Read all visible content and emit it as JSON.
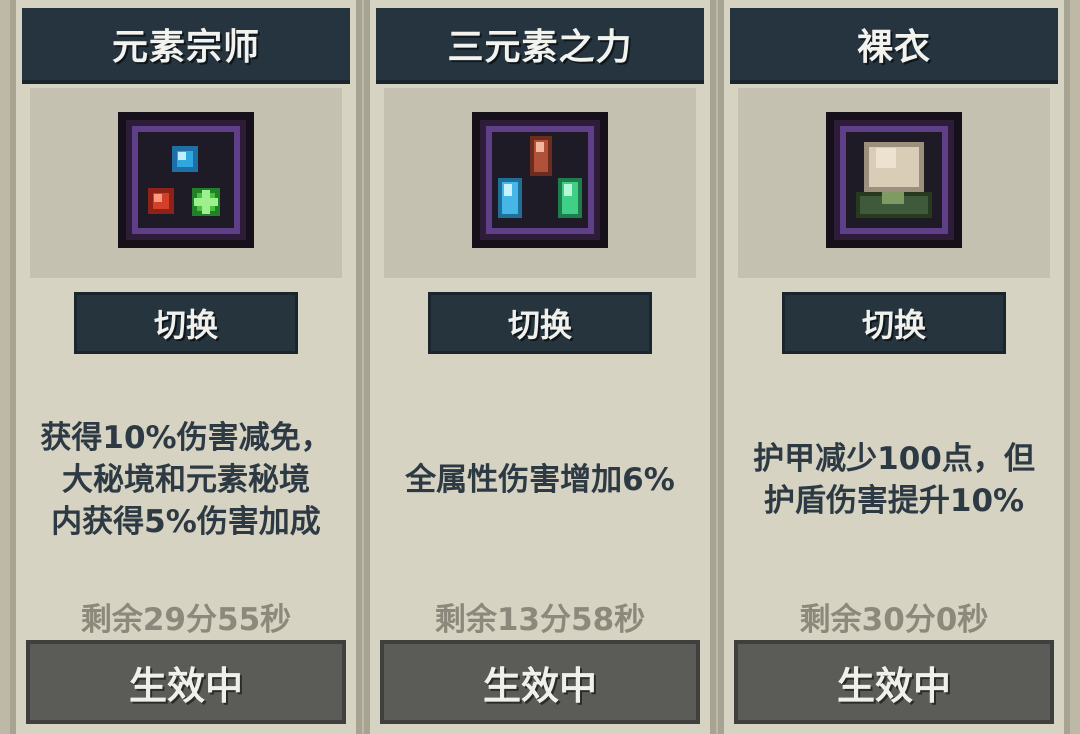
{
  "cards": [
    {
      "title": "元素宗师",
      "icon": "element-gems-icon",
      "switch_label": "切换",
      "description": "获得10%伤害减免，\n大秘境和元素秘境\n内获得5%伤害加成",
      "timer": "剩余29分55秒",
      "status": "生效中"
    },
    {
      "title": "三元素之力",
      "icon": "three-crystals-icon",
      "switch_label": "切换",
      "description": "全属性伤害增加6%",
      "timer": "剩余13分58秒",
      "status": "生效中"
    },
    {
      "title": "裸衣",
      "icon": "bare-armor-icon",
      "switch_label": "切换",
      "description": "护甲减少100点，但\n护盾伤害提升10%",
      "timer": "剩余30分0秒",
      "status": "生效中"
    }
  ],
  "colors": {
    "header_bg": "#25343f",
    "card_bg": "#d6d3c3",
    "active_button_bg": "#5b5b58",
    "text_dark": "#2e3a43",
    "timer_text": "#8c887b",
    "icon_frame_border": "#5e3f88"
  }
}
